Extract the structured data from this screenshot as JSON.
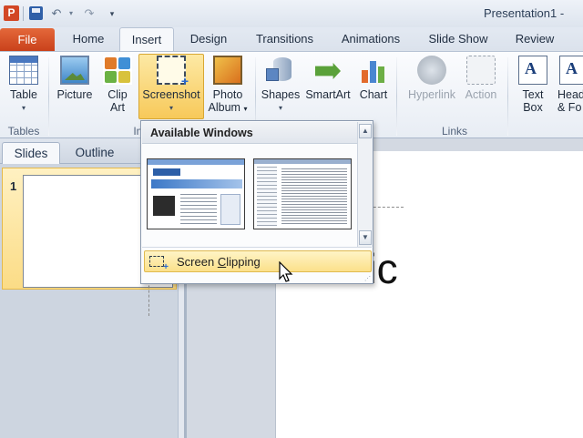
{
  "title_bar": {
    "app_icon": "P",
    "window_title": "Presentation1 - ",
    "qat": {
      "save_icon": "save-icon",
      "undo_glyph": "↶",
      "dd_glyph": "▾",
      "redo_glyph": "↷",
      "customize_glyph": "▾"
    }
  },
  "tabs": [
    "File",
    "Home",
    "Insert",
    "Design",
    "Transitions",
    "Animations",
    "Slide Show",
    "Review"
  ],
  "active_tab": "Insert",
  "ribbon": {
    "table_line": "Table",
    "picture": "Picture",
    "clip_line1": "Clip",
    "clip_line2": "Art",
    "screenshot": "Screenshot",
    "photo_line1": "Photo",
    "photo_line2": "Album",
    "shapes": "Shapes",
    "smartart": "SmartArt",
    "chart": "Chart",
    "hyperlink": "Hyperlink",
    "action": "Action",
    "textbox_line1": "Text",
    "textbox_line2": "Box",
    "header_line1": "Head",
    "header_line2": "& Fo",
    "group_tables": "Tables",
    "group_images": "Im",
    "group_links": "Links",
    "caret": "▾"
  },
  "dropdown": {
    "header": "Available Windows",
    "clipping_label_before": "Screen ",
    "clipping_label_mnemonic": "C",
    "clipping_label_after": "lipping",
    "scroll_up": "▲",
    "scroll_down": "▼",
    "grip": "⋰"
  },
  "left_pane": {
    "tabs": [
      "Slides",
      "Outline"
    ],
    "active_tab": "Slides",
    "slide_number": "1"
  },
  "slide": {
    "placeholder_text": "Clic"
  },
  "colors": {
    "file_tab": "#d24726",
    "highlight": "#f7c95a",
    "accent": "#2a6ad1"
  }
}
